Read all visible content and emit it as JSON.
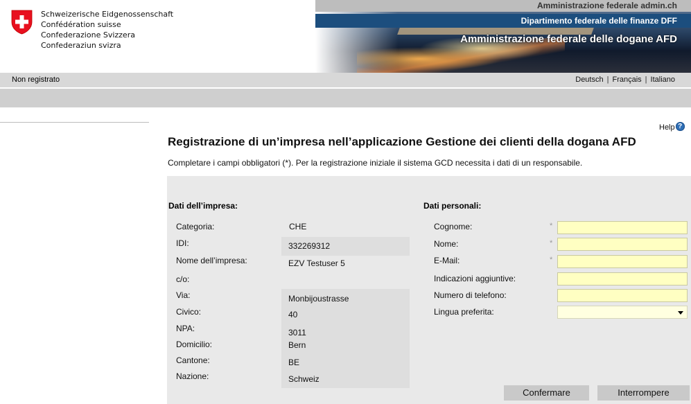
{
  "header": {
    "confederation_lines": [
      "Schweizerische Eidgenossenschaft",
      "Confédération suisse",
      "Confederazione Svizzera",
      "Confederaziun svizra"
    ],
    "admin_site": "Amministrazione federale admin.ch",
    "department": "Dipartimento federale delle finanze DFF",
    "office": "Amministrazione federale delle dogane AFD"
  },
  "status": {
    "user": "Non registrato",
    "languages": [
      "Deutsch",
      "Français",
      "Italiano"
    ],
    "separator": "|"
  },
  "help": {
    "label": "Help",
    "icon": "question-icon"
  },
  "page": {
    "title": "Registrazione di un’impresa nell’applicazione Gestione dei clienti della dogana AFD",
    "subtitle": "Completare i campi obbligatori (*). Per la registrazione iniziale il sistema GCD necessita i dati di un responsabile."
  },
  "company": {
    "heading": "Dati dell’impresa:",
    "fields": [
      {
        "label": "Categoria:",
        "value": "CHE"
      },
      {
        "label": "IDI:",
        "value": "332269312"
      },
      {
        "label": "Nome dell’impresa:",
        "value": "EZV Testuser 5"
      },
      {
        "label": "c/o:",
        "value": ""
      },
      {
        "label": "Via:",
        "value": "Monbijoustrasse"
      },
      {
        "label": "Civico:",
        "value": "40"
      },
      {
        "label": "NPA:",
        "value": "3011"
      },
      {
        "label": "Domicilio:",
        "value": "Bern"
      },
      {
        "label": "Cantone:",
        "value": "BE"
      },
      {
        "label": "Nazione:",
        "value": "Schweiz"
      }
    ]
  },
  "personal": {
    "heading": "Dati personali:",
    "required_mark": "*",
    "fields": [
      {
        "label": "Cognome:",
        "value": "",
        "required": true
      },
      {
        "label": "Nome:",
        "value": "",
        "required": true
      },
      {
        "label": "E-Mail:",
        "value": "",
        "required": true
      },
      {
        "label": "Indicazioni aggiuntive:",
        "value": "",
        "required": false
      },
      {
        "label": "Numero di telefono:",
        "value": "",
        "required": false
      },
      {
        "label": "Lingua preferita:",
        "value": "",
        "required": false
      }
    ]
  },
  "buttons": {
    "confirm": "Confermare",
    "cancel": "Interrompere"
  },
  "colors": {
    "accent_blue": "#1c4e7e",
    "required_field": "#ffffc2",
    "panel": "#e9e9e9",
    "swiss_red": "#e8101f"
  }
}
